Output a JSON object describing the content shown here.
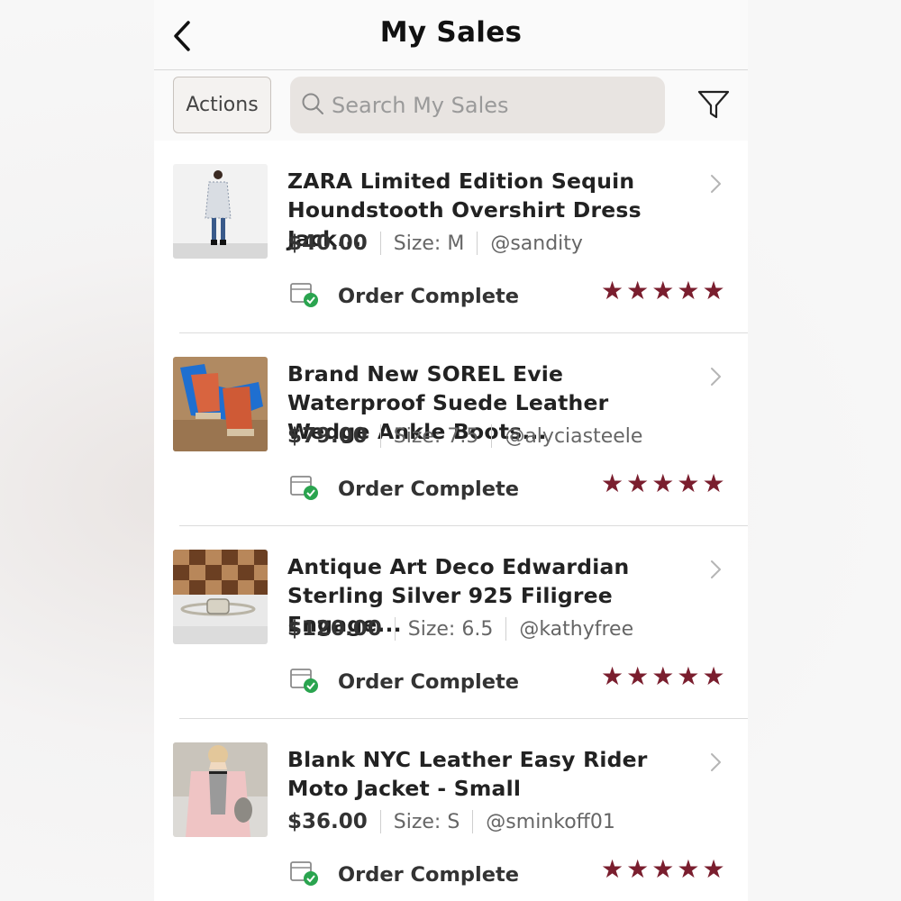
{
  "header": {
    "title": "My Sales"
  },
  "toolbar": {
    "actions_label": "Actions",
    "search_placeholder": "Search My Sales"
  },
  "colors": {
    "star": "#7a1e2e",
    "check": "#2aa44f",
    "search_bg": "#e8e4e1"
  },
  "icons": {
    "back": "back-arrow-icon",
    "search": "search-icon",
    "filter": "filter-icon",
    "chevron": "chevron-right-icon",
    "order": "order-complete-icon",
    "star": "star-icon"
  },
  "sales": [
    {
      "title": "ZARA Limited Edition Sequin Houndstooth Overshirt Dress Jack...",
      "price": "$40.00",
      "size": "Size: M",
      "buyer": "@sandity",
      "status": "Order Complete",
      "rating": 5
    },
    {
      "title": "Brand New SOREL Evie Waterproof Suede Leather Wedge Ankle Boots...",
      "price": "$79.00",
      "size": "Size: 7.5",
      "buyer": "@alyciasteele",
      "status": "Order Complete",
      "rating": 5
    },
    {
      "title": "Antique Art Deco Edwardian Sterling Silver 925 Filigree Engage...",
      "price": "$120.00",
      "size": "Size: 6.5",
      "buyer": "@kathyfree",
      "status": "Order Complete",
      "rating": 5
    },
    {
      "title": "Blank NYC Leather Easy Rider Moto Jacket - Small",
      "price": "$36.00",
      "size": "Size: S",
      "buyer": "@sminkoff01",
      "status": "Order Complete",
      "rating": 5
    }
  ]
}
